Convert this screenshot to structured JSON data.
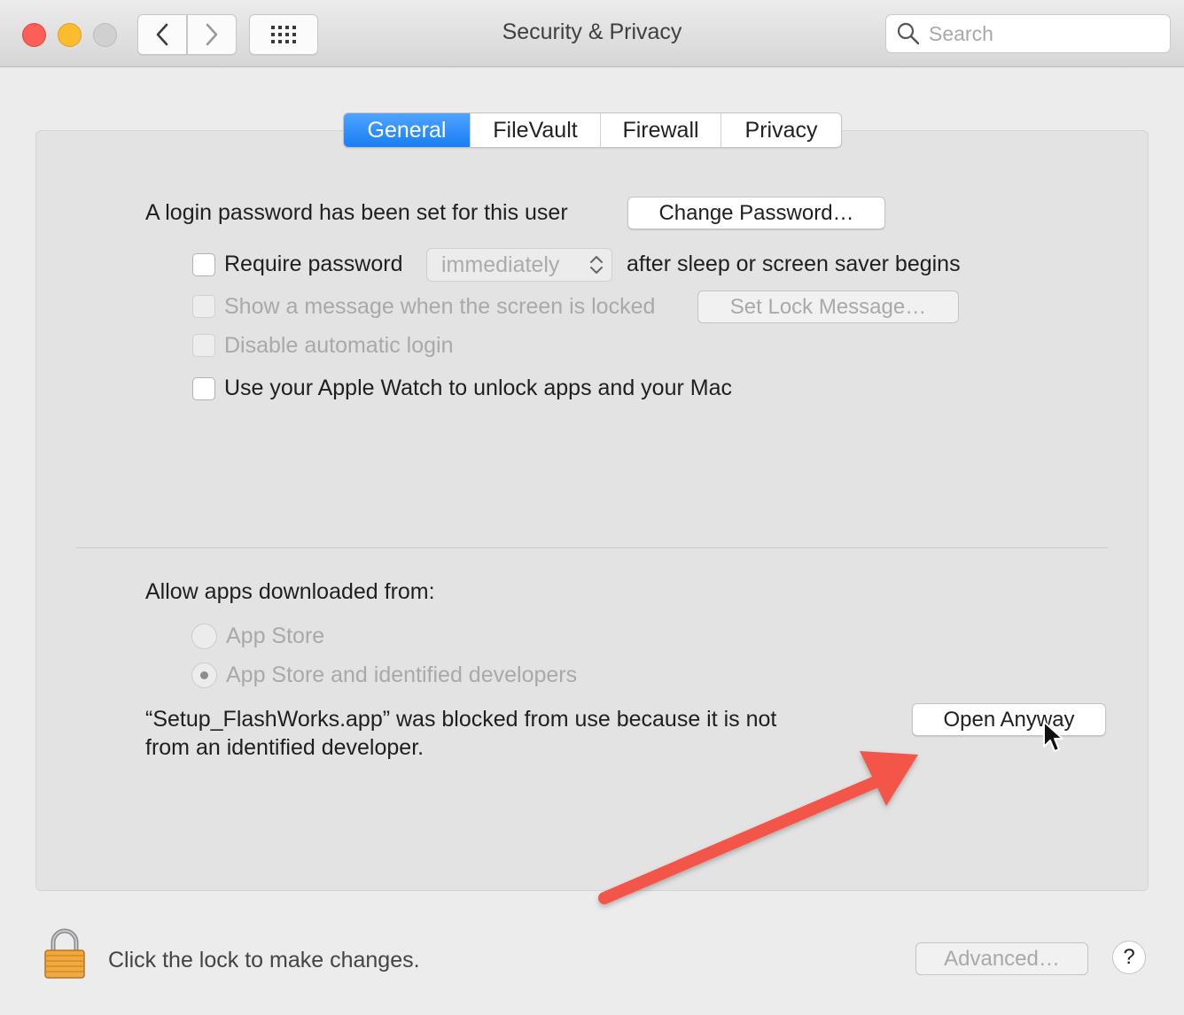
{
  "window": {
    "title": "Security & Privacy",
    "search_placeholder": "Search"
  },
  "tabs": [
    {
      "label": "General",
      "active": true
    },
    {
      "label": "FileVault",
      "active": false
    },
    {
      "label": "Firewall",
      "active": false
    },
    {
      "label": "Privacy",
      "active": false
    }
  ],
  "general": {
    "login_password_text": "A login password has been set for this user",
    "change_password_label": "Change Password…",
    "require_password_label": "Require password",
    "require_password_checked": false,
    "require_password_delay": "immediately",
    "after_sleep_label": "after sleep or screen saver begins",
    "show_message_label": "Show a message when the screen is locked",
    "set_lock_message_label": "Set Lock Message…",
    "disable_auto_login_label": "Disable automatic login",
    "apple_watch_label": "Use your Apple Watch to unlock apps and your Mac",
    "allow_apps_label": "Allow apps downloaded from:",
    "radio_app_store": "App Store",
    "radio_identified": "App Store and identified developers",
    "selected_source": "App Store and identified developers",
    "blocked_message_line1": "“Setup_FlashWorks.app” was blocked from use because it is not",
    "blocked_message_line2": "from an identified developer.",
    "open_anyway_label": "Open Anyway"
  },
  "footer": {
    "lock_text": "Click the lock to make changes.",
    "advanced_label": "Advanced…",
    "help_label": "?"
  },
  "colors": {
    "accent": "#1a7ef5",
    "annotation_arrow": "#f4554a",
    "close": "#fc5f57",
    "minimize": "#fdbc2e"
  }
}
